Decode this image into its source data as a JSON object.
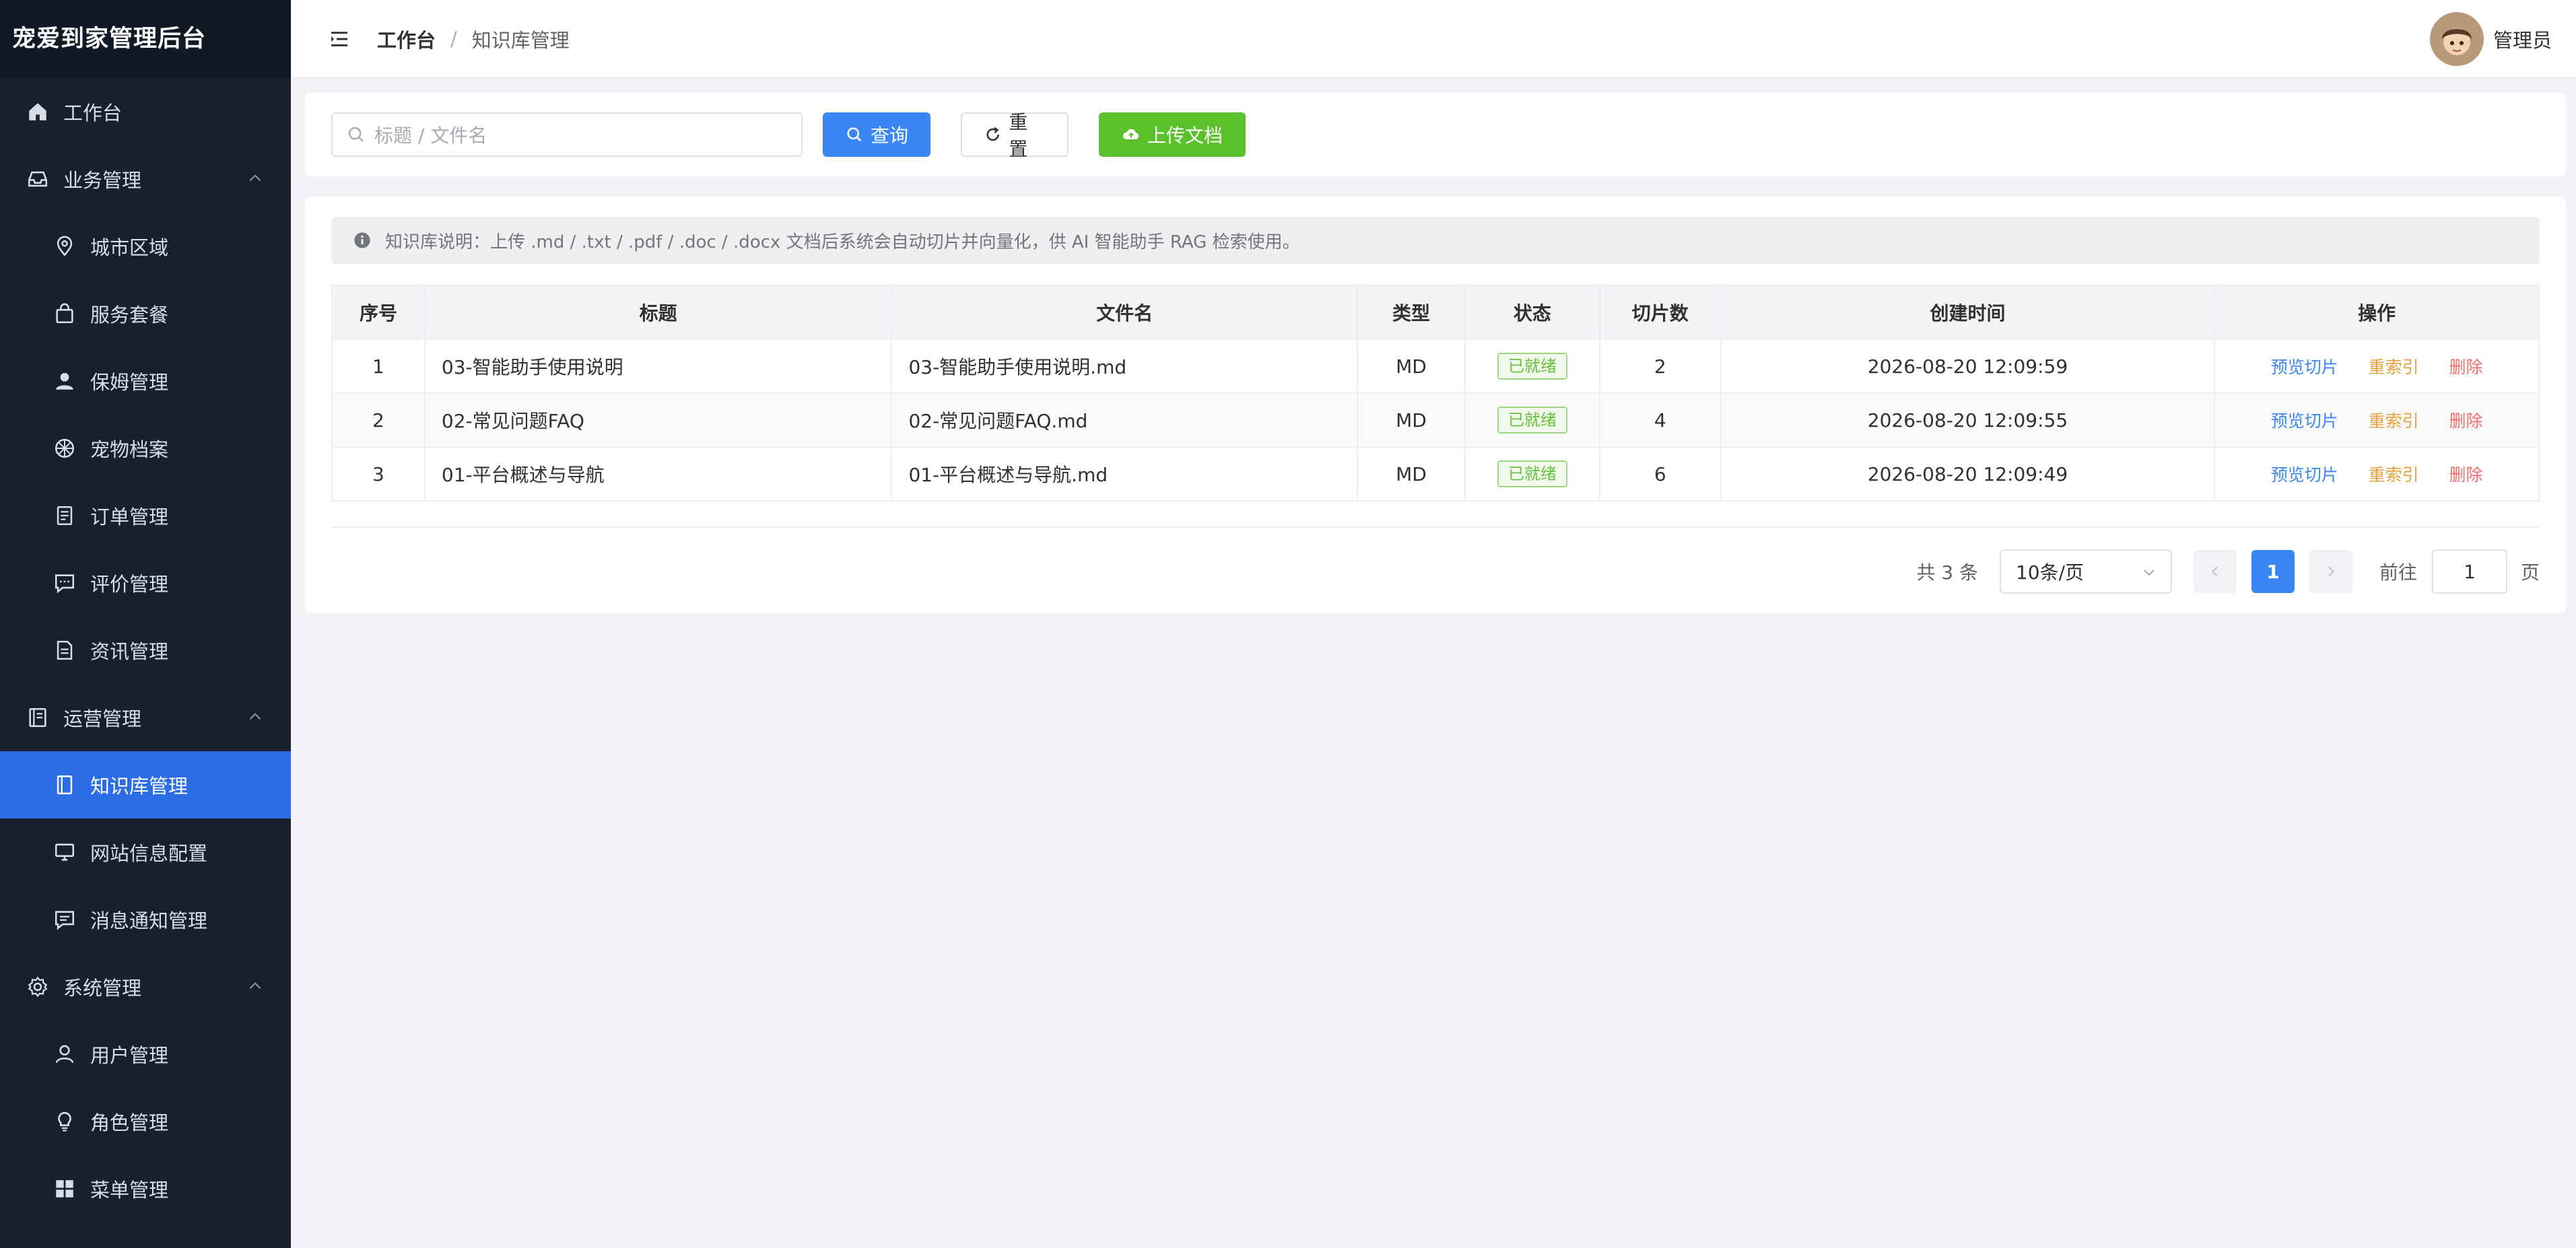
{
  "app": {
    "title": "宠爱到家管理后台"
  },
  "sidebar": {
    "items": [
      {
        "label": "工作台",
        "icon": "home-icon"
      },
      {
        "label": "业务管理",
        "icon": "inbox-icon",
        "group": true
      },
      {
        "label": "城市区域",
        "icon": "location-icon"
      },
      {
        "label": "服务套餐",
        "icon": "bag-icon"
      },
      {
        "label": "保姆管理",
        "icon": "user-icon"
      },
      {
        "label": "宠物档案",
        "icon": "paw-icon"
      },
      {
        "label": "订单管理",
        "icon": "document-icon"
      },
      {
        "label": "评价管理",
        "icon": "chat-icon"
      },
      {
        "label": "资讯管理",
        "icon": "news-icon"
      },
      {
        "label": "运营管理",
        "icon": "notebook-icon",
        "group": true
      },
      {
        "label": "知识库管理",
        "icon": "book-icon",
        "active": true
      },
      {
        "label": "网站信息配置",
        "icon": "monitor-icon"
      },
      {
        "label": "消息通知管理",
        "icon": "message-icon"
      },
      {
        "label": "系统管理",
        "icon": "gear-icon",
        "group": true
      },
      {
        "label": "用户管理",
        "icon": "user-outline-icon"
      },
      {
        "label": "角色管理",
        "icon": "bulb-icon"
      },
      {
        "label": "菜单管理",
        "icon": "grid-icon"
      }
    ]
  },
  "header": {
    "breadcrumb_home": "工作台",
    "breadcrumb_sep": "/",
    "breadcrumb_current": "知识库管理",
    "user_name": "管理员"
  },
  "search": {
    "placeholder": "标题 / 文件名",
    "query_label": "查询",
    "reset_label": "重置",
    "upload_label": "上传文档"
  },
  "notice": "知识库说明：上传 .md / .txt / .pdf / .doc / .docx 文档后系统会自动切片并向量化，供 AI 智能助手 RAG 检索使用。",
  "table": {
    "headers": [
      "序号",
      "标题",
      "文件名",
      "类型",
      "状态",
      "切片数",
      "创建时间",
      "操作"
    ],
    "rows": [
      {
        "index": "1",
        "title": "03-智能助手使用说明",
        "filename": "03-智能助手使用说明.md",
        "type": "MD",
        "status": "已就绪",
        "chunks": "2",
        "created": "2026-08-20 12:09:59"
      },
      {
        "index": "2",
        "title": "02-常见问题FAQ",
        "filename": "02-常见问题FAQ.md",
        "type": "MD",
        "status": "已就绪",
        "chunks": "4",
        "created": "2026-08-20 12:09:55"
      },
      {
        "index": "3",
        "title": "01-平台概述与导航",
        "filename": "01-平台概述与导航.md",
        "type": "MD",
        "status": "已就绪",
        "chunks": "6",
        "created": "2026-08-20 12:09:49"
      }
    ],
    "actions": {
      "preview": "预览切片",
      "reindex": "重索引",
      "delete": "删除"
    }
  },
  "pagination": {
    "total": "共 3 条",
    "page_size": "10条/页",
    "current_page": "1",
    "goto_label": "前往",
    "goto_value": "1",
    "goto_unit": "页"
  },
  "colors": {
    "sidebar_bg": "#17202e",
    "active": "#2b6de6",
    "primary": "#3a86f7",
    "success": "#5ac12c",
    "warning": "#e6a23c",
    "danger": "#f56c6c"
  }
}
